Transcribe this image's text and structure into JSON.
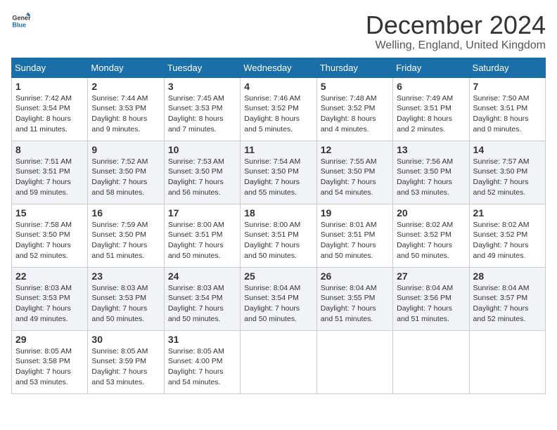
{
  "logo": {
    "line1": "General",
    "line2": "Blue"
  },
  "title": "December 2024",
  "subtitle": "Welling, England, United Kingdom",
  "days_of_week": [
    "Sunday",
    "Monday",
    "Tuesday",
    "Wednesday",
    "Thursday",
    "Friday",
    "Saturday"
  ],
  "weeks": [
    [
      {
        "day": "1",
        "sunrise": "7:42 AM",
        "sunset": "3:54 PM",
        "daylight": "8 hours and 11 minutes."
      },
      {
        "day": "2",
        "sunrise": "7:44 AM",
        "sunset": "3:53 PM",
        "daylight": "8 hours and 9 minutes."
      },
      {
        "day": "3",
        "sunrise": "7:45 AM",
        "sunset": "3:53 PM",
        "daylight": "8 hours and 7 minutes."
      },
      {
        "day": "4",
        "sunrise": "7:46 AM",
        "sunset": "3:52 PM",
        "daylight": "8 hours and 5 minutes."
      },
      {
        "day": "5",
        "sunrise": "7:48 AM",
        "sunset": "3:52 PM",
        "daylight": "8 hours and 4 minutes."
      },
      {
        "day": "6",
        "sunrise": "7:49 AM",
        "sunset": "3:51 PM",
        "daylight": "8 hours and 2 minutes."
      },
      {
        "day": "7",
        "sunrise": "7:50 AM",
        "sunset": "3:51 PM",
        "daylight": "8 hours and 0 minutes."
      }
    ],
    [
      {
        "day": "8",
        "sunrise": "7:51 AM",
        "sunset": "3:51 PM",
        "daylight": "7 hours and 59 minutes."
      },
      {
        "day": "9",
        "sunrise": "7:52 AM",
        "sunset": "3:50 PM",
        "daylight": "7 hours and 58 minutes."
      },
      {
        "day": "10",
        "sunrise": "7:53 AM",
        "sunset": "3:50 PM",
        "daylight": "7 hours and 56 minutes."
      },
      {
        "day": "11",
        "sunrise": "7:54 AM",
        "sunset": "3:50 PM",
        "daylight": "7 hours and 55 minutes."
      },
      {
        "day": "12",
        "sunrise": "7:55 AM",
        "sunset": "3:50 PM",
        "daylight": "7 hours and 54 minutes."
      },
      {
        "day": "13",
        "sunrise": "7:56 AM",
        "sunset": "3:50 PM",
        "daylight": "7 hours and 53 minutes."
      },
      {
        "day": "14",
        "sunrise": "7:57 AM",
        "sunset": "3:50 PM",
        "daylight": "7 hours and 52 minutes."
      }
    ],
    [
      {
        "day": "15",
        "sunrise": "7:58 AM",
        "sunset": "3:50 PM",
        "daylight": "7 hours and 52 minutes."
      },
      {
        "day": "16",
        "sunrise": "7:59 AM",
        "sunset": "3:50 PM",
        "daylight": "7 hours and 51 minutes."
      },
      {
        "day": "17",
        "sunrise": "8:00 AM",
        "sunset": "3:51 PM",
        "daylight": "7 hours and 50 minutes."
      },
      {
        "day": "18",
        "sunrise": "8:00 AM",
        "sunset": "3:51 PM",
        "daylight": "7 hours and 50 minutes."
      },
      {
        "day": "19",
        "sunrise": "8:01 AM",
        "sunset": "3:51 PM",
        "daylight": "7 hours and 50 minutes."
      },
      {
        "day": "20",
        "sunrise": "8:02 AM",
        "sunset": "3:52 PM",
        "daylight": "7 hours and 50 minutes."
      },
      {
        "day": "21",
        "sunrise": "8:02 AM",
        "sunset": "3:52 PM",
        "daylight": "7 hours and 49 minutes."
      }
    ],
    [
      {
        "day": "22",
        "sunrise": "8:03 AM",
        "sunset": "3:53 PM",
        "daylight": "7 hours and 49 minutes."
      },
      {
        "day": "23",
        "sunrise": "8:03 AM",
        "sunset": "3:53 PM",
        "daylight": "7 hours and 50 minutes."
      },
      {
        "day": "24",
        "sunrise": "8:03 AM",
        "sunset": "3:54 PM",
        "daylight": "7 hours and 50 minutes."
      },
      {
        "day": "25",
        "sunrise": "8:04 AM",
        "sunset": "3:54 PM",
        "daylight": "7 hours and 50 minutes."
      },
      {
        "day": "26",
        "sunrise": "8:04 AM",
        "sunset": "3:55 PM",
        "daylight": "7 hours and 51 minutes."
      },
      {
        "day": "27",
        "sunrise": "8:04 AM",
        "sunset": "3:56 PM",
        "daylight": "7 hours and 51 minutes."
      },
      {
        "day": "28",
        "sunrise": "8:04 AM",
        "sunset": "3:57 PM",
        "daylight": "7 hours and 52 minutes."
      }
    ],
    [
      {
        "day": "29",
        "sunrise": "8:05 AM",
        "sunset": "3:58 PM",
        "daylight": "7 hours and 53 minutes."
      },
      {
        "day": "30",
        "sunrise": "8:05 AM",
        "sunset": "3:59 PM",
        "daylight": "7 hours and 53 minutes."
      },
      {
        "day": "31",
        "sunrise": "8:05 AM",
        "sunset": "4:00 PM",
        "daylight": "7 hours and 54 minutes."
      },
      null,
      null,
      null,
      null
    ]
  ],
  "labels": {
    "sunrise": "Sunrise:",
    "sunset": "Sunset:",
    "daylight": "Daylight:"
  }
}
